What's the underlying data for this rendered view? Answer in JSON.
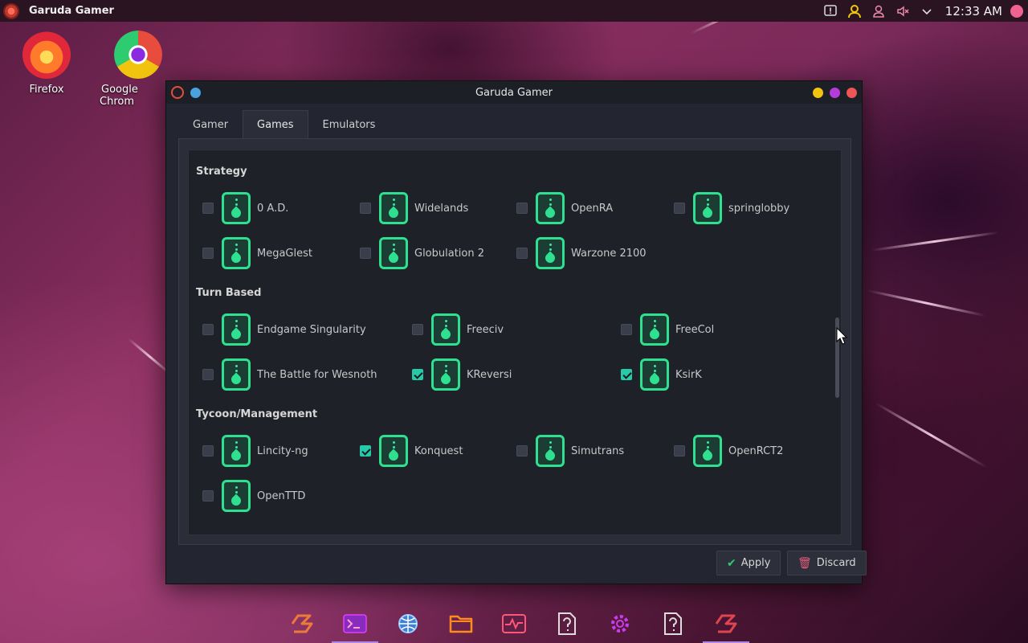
{
  "panel": {
    "active_app": "Garuda Gamer",
    "clock": "12:33 AM"
  },
  "desktop": {
    "icons": [
      {
        "label": "Firefox",
        "icon": "firefox-icon"
      },
      {
        "label": "Google Chrom",
        "icon": "chrome-icon"
      }
    ]
  },
  "window": {
    "title": "Garuda Gamer",
    "tabs": [
      "Gamer",
      "Games",
      "Emulators"
    ],
    "active_tab": "Games",
    "sections": [
      {
        "title": "Strategy",
        "games": [
          {
            "name": "0 A.D.",
            "checked": false
          },
          {
            "name": "Widelands",
            "checked": false
          },
          {
            "name": "OpenRA",
            "checked": false
          },
          {
            "name": "springlobby",
            "checked": false
          },
          {
            "name": "MegaGlest",
            "checked": false
          },
          {
            "name": "Globulation 2",
            "checked": false
          },
          {
            "name": "Warzone 2100",
            "checked": false
          }
        ]
      },
      {
        "title": "Turn Based",
        "games": [
          {
            "name": "Endgame Singularity",
            "checked": false
          },
          {
            "name": "Freeciv",
            "checked": false
          },
          {
            "name": "FreeCol",
            "checked": false
          },
          {
            "name": "The Battle for Wesnoth",
            "checked": false
          },
          {
            "name": "KReversi",
            "checked": true
          },
          {
            "name": "KsirK",
            "checked": true
          }
        ]
      },
      {
        "title": "Tycoon/Management",
        "games": [
          {
            "name": "Lincity-ng",
            "checked": false
          },
          {
            "name": "Konquest",
            "checked": true
          },
          {
            "name": "Simutrans",
            "checked": false
          },
          {
            "name": "OpenRCT2",
            "checked": false
          },
          {
            "name": "OpenTTD",
            "checked": false
          }
        ]
      }
    ],
    "buttons": {
      "apply": "Apply",
      "discard": "Discard"
    }
  },
  "colors": {
    "accent": "#2ee08f",
    "checkbox_checked": "#26c9a8",
    "window_bg": "#232530"
  },
  "dock": {
    "items": [
      "garuda-logo-icon",
      "terminal-icon",
      "network-settings-icon",
      "files-icon",
      "system-monitor-icon",
      "help-icon",
      "settings-icon",
      "help-icon",
      "garuda-gamer-icon"
    ]
  }
}
